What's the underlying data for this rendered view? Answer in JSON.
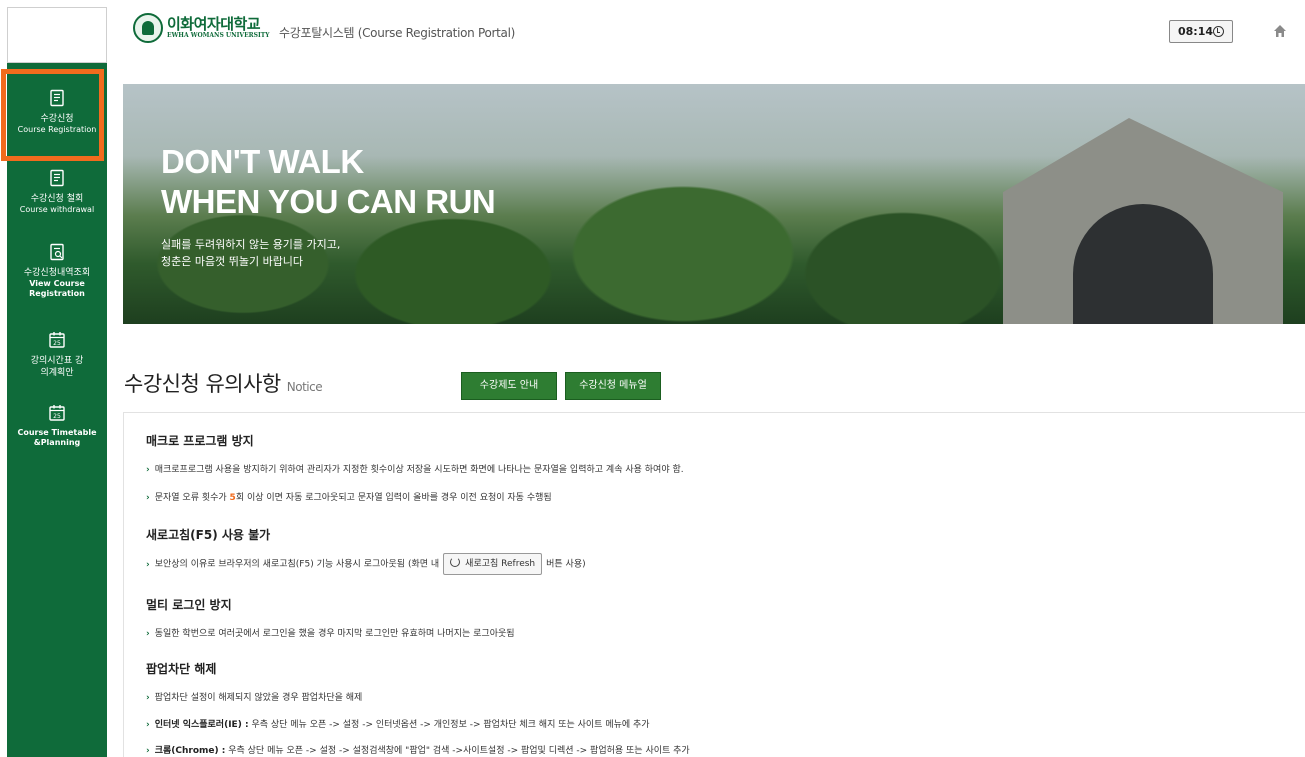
{
  "header": {
    "logo_ko": "이화여자대학교",
    "logo_en": "EWHA WOMANS UNIVERSITY",
    "portal_title": "수강포탈시스템 (Course Registration Portal)",
    "timer": "08:14"
  },
  "sidebar": {
    "items": [
      {
        "label_ko": "수강신청",
        "label_en": "Course Registration",
        "icon": "document-icon"
      },
      {
        "label_ko": "수강신청 철회",
        "label_en": "Course withdrawal",
        "icon": "document-icon"
      },
      {
        "label_ko": "수강신청내역조회",
        "label_en": "View Course Registration",
        "icon": "document-search-icon"
      },
      {
        "label_ko": "강의시간표 강의계획안",
        "label_en": "",
        "icon": "calendar-icon"
      },
      {
        "label_ko": "",
        "label_en": "Course Timetable &Planning",
        "icon": "calendar-icon"
      }
    ],
    "calendar_day": "25"
  },
  "banner": {
    "title_line1": "DON'T WALK",
    "title_line2": "WHEN YOU CAN RUN",
    "sub_line1": "실패를 두려워하지 않는 용기를 가지고,",
    "sub_line2": "청춘은 마음껏 뛰놀기 바랍니다"
  },
  "notice": {
    "title": "수강신청 유의사항",
    "title_en": "Notice",
    "btn_guide": "수강제도 안내",
    "btn_manual": "수강신청 메뉴얼",
    "sections": [
      {
        "title": "매크로 프로그램 방지",
        "bullets": [
          "매크로프로그램 사용을 방지하기 위하여 관리자가 지정한 횟수이상 저장을 시도하면 화면에 나타나는 문자열을 입력하고 계속 사용 하여야 함.",
          "문자열 오류 횟수가 5회 이상 이면 자동 로그아웃되고 문자열 입력이 올바를 경우 이전 요청이 자동 수행됨"
        ]
      },
      {
        "title": "새로고침(F5) 사용 불가",
        "bullet_pre": "보안상의 이유로 브라우저의 새로고침(F5) 기능 사용시 로그아웃됨 (화면 내",
        "refresh_label": "새로고침 Refresh",
        "bullet_post": "버튼 사용)"
      },
      {
        "title": "멀티 로그인 방지",
        "bullets": [
          "동일한 학번으로 여러곳에서 로그인을 했을 경우 마지막 로그인만 유효하며 나머지는 로그아웃됨"
        ]
      },
      {
        "title": "팝업차단 해제",
        "bullets": [
          "팝업차단 설정이 해제되지 않았을 경우 팝업차단을 해제"
        ],
        "ie_label": "인터넷 익스플로러(IE) :",
        "ie_text": "우측 상단 메뉴 오픈 -> 설정 -> 인터넷옵션 -> 개인정보 -> 팝업차단 체크 해지 또는 사이트 메뉴에 추가",
        "chrome_label": "크롬(Chrome) :",
        "chrome_text": "우측 상단 메뉴 오픈 -> 설정 -> 설정검색창에 \"팝업\" 검색 ->사이트설정 -> 팝업및 디렉션 -> 팝업허용 또는 사이트 추가"
      }
    ],
    "bullet2_pre": "문자열 오류 횟수가 ",
    "bullet2_em": "5",
    "bullet2_post": "회 이상 이면 자동 로그아웃되고 문자열 입력이 올바를 경우 이전 요청이 자동 수행됨"
  },
  "colors": {
    "brand_green": "#0f6b3a",
    "button_green": "#2e7d32",
    "active_outline": "#f26b1d"
  }
}
